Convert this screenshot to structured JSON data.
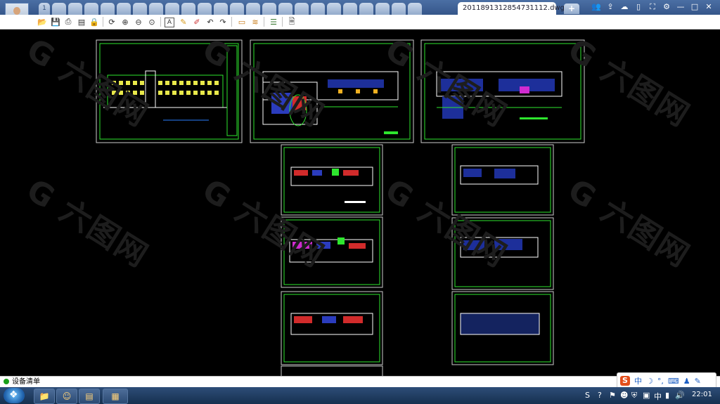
{
  "window": {
    "document_tab": "2011891312854731112.dwg",
    "close_glyph": "×",
    "new_tab_glyph": "+",
    "tabs": [
      "1",
      "",
      "",
      "",
      "",
      "",
      "",
      "",
      "",
      "",
      "",
      "",
      "",
      "",
      "",
      "",
      "",
      "",
      "",
      "",
      "",
      "",
      "",
      ""
    ],
    "window_buttons": [
      "—",
      "□",
      "✕"
    ]
  },
  "toolbar": {
    "icons": [
      "open-icon",
      "save-icon",
      "print-icon",
      "pdf-icon",
      "lock-icon",
      "rotate-icon",
      "zoom-in-icon",
      "zoom-out-icon",
      "zoom-extent-icon",
      "text-icon",
      "pencil-icon",
      "marker-icon",
      "undo-icon",
      "redo-icon",
      "measure-icon",
      "dimension-icon",
      "layers-icon",
      "export-icon"
    ]
  },
  "status_line": {
    "text": "设备清单"
  },
  "watermark": {
    "text": "G 六图网"
  },
  "ime": {
    "lang": "中",
    "extras": [
      "☽",
      "°,",
      "⌨",
      "♟",
      "✎"
    ]
  },
  "taskbar": {
    "time": "22:01"
  },
  "colors": {
    "sheet_border": "#2ee62e",
    "tabbar": "#3f6298",
    "background": "#000000"
  }
}
